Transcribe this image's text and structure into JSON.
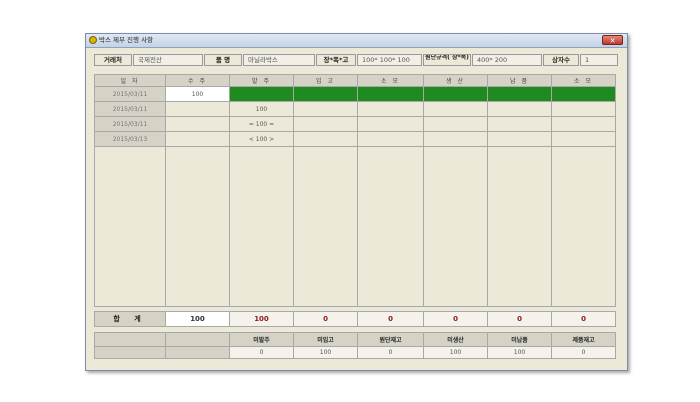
{
  "window": {
    "title": "박스 제부 진행 사항",
    "close_label": "✕"
  },
  "header": {
    "client_label": "거래처",
    "client_value": "국제전산",
    "product_label": "품 명",
    "product_value": "마닐라박스",
    "dims_label": "장*폭*고",
    "dims_value": "100* 100* 100",
    "cut_label": "원단규격( 장*폭)",
    "cut_value": "400* 200",
    "boxes_label": "상자수",
    "boxes_value": "1"
  },
  "table": {
    "columns": [
      "일 자",
      "수 주",
      "발 주",
      "입 고",
      "소 모",
      "생 산",
      "납 품",
      "소 모"
    ],
    "rows": [
      {
        "date": "2015/03/11",
        "order": "100",
        "purchase": "",
        "green": true
      },
      {
        "date": "2015/03/11",
        "order": "",
        "purchase": "100",
        "green": false
      },
      {
        "date": "2015/03/11",
        "order": "",
        "purchase": "= 100 =",
        "green": false
      },
      {
        "date": "2015/03/13",
        "order": "",
        "purchase": "< 100 >",
        "green": false
      }
    ],
    "total": {
      "label": "합 계",
      "values": [
        "100",
        "100",
        "0",
        "0",
        "0",
        "0",
        "0"
      ]
    }
  },
  "summary": {
    "headers": [
      "미발주",
      "미입고",
      "원단재고",
      "미생산",
      "미납품",
      "제품재고"
    ],
    "values": [
      "0",
      "100",
      "0",
      "100",
      "100",
      "0"
    ]
  },
  "colors": {
    "progress_fill": "#1f8a1f",
    "window_bg": "#ece9d8"
  }
}
